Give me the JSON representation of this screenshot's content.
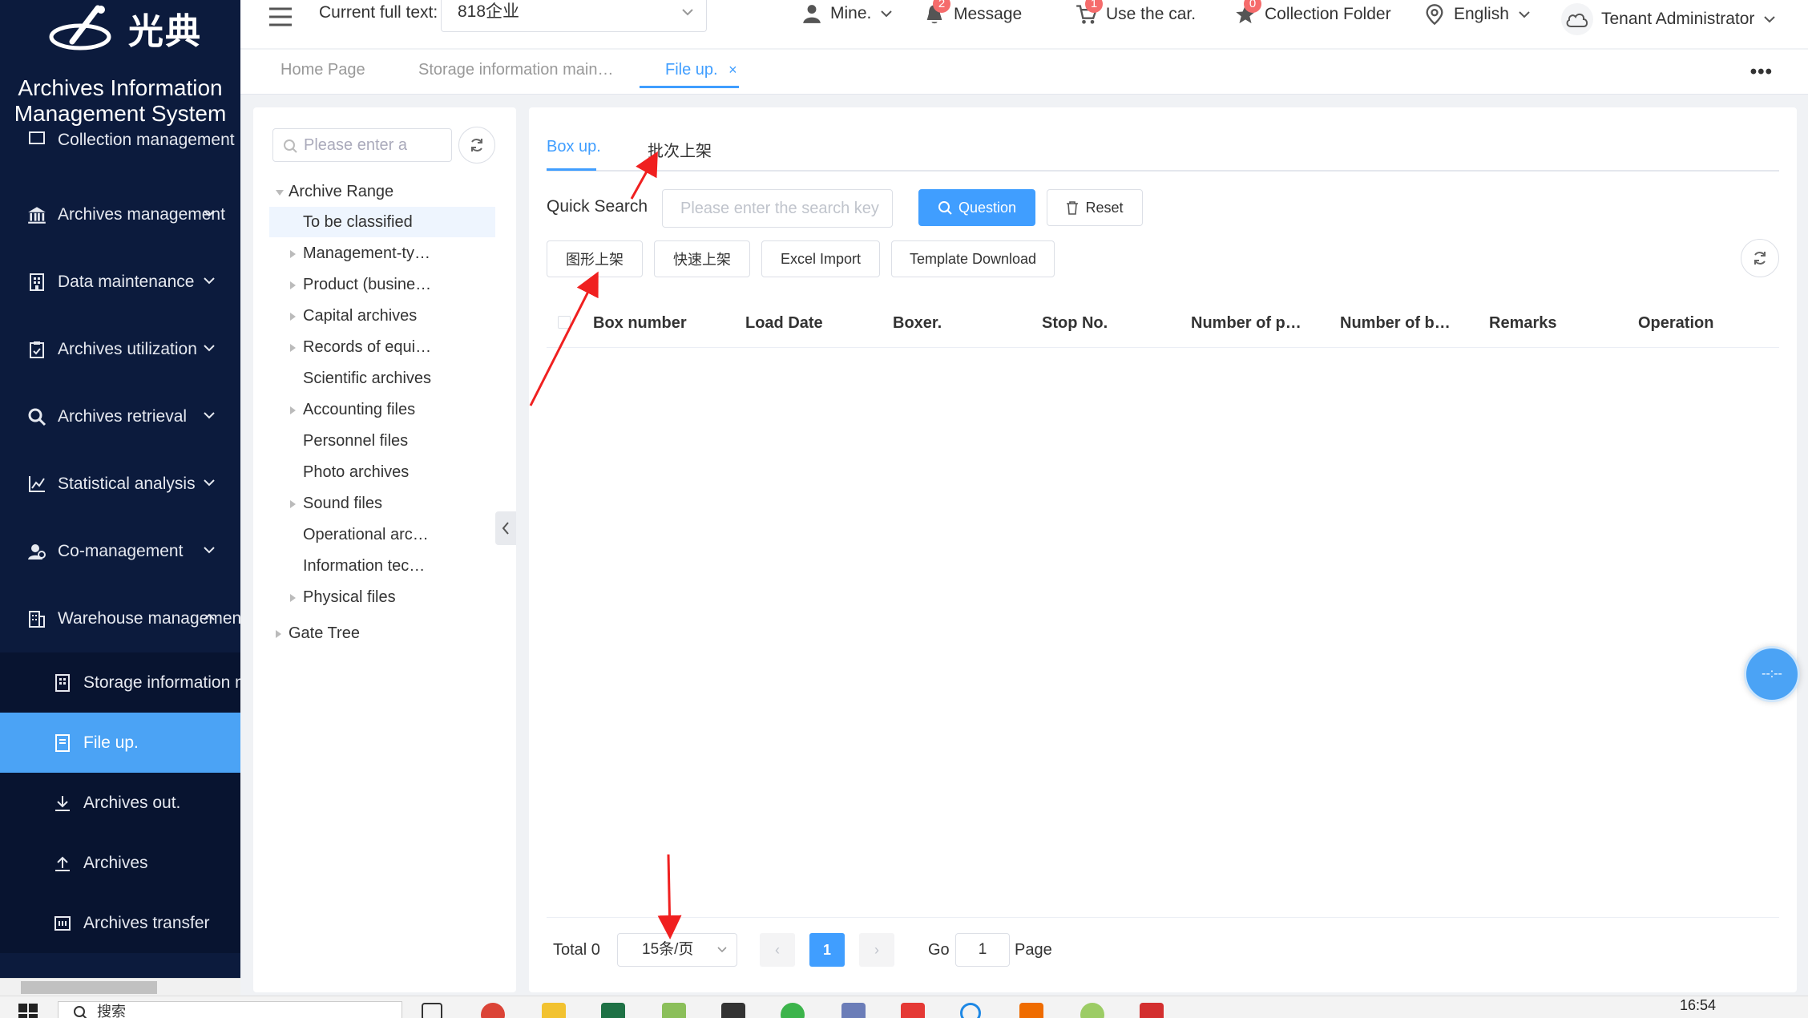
{
  "app": {
    "logo_text": "光典",
    "system_title_line1": "Archives Information",
    "system_title_line2": "Management System"
  },
  "sidebar": {
    "items": [
      {
        "label": "Collection management",
        "icon": "collection-icon"
      },
      {
        "label": "Archives management",
        "icon": "bank-icon"
      },
      {
        "label": "Data maintenance",
        "icon": "building-icon"
      },
      {
        "label": "Archives utilization",
        "icon": "clipboard-icon"
      },
      {
        "label": "Archives retrieval",
        "icon": "search-icon"
      },
      {
        "label": "Statistical analysis",
        "icon": "chart-icon"
      },
      {
        "label": "Co-management",
        "icon": "users-icon"
      },
      {
        "label": "Warehouse management",
        "icon": "warehouse-icon"
      }
    ],
    "sub_items": [
      {
        "label": "Storage information m",
        "icon": "building-icon"
      },
      {
        "label": "File up.",
        "icon": "file-icon"
      },
      {
        "label": "Archives out.",
        "icon": "download-icon"
      },
      {
        "label": "Archives",
        "icon": "upload-icon"
      },
      {
        "label": "Archives transfer",
        "icon": "transfer-icon"
      }
    ]
  },
  "header": {
    "fulltext_label": "Current full text:",
    "fulltext_value": "818企业",
    "mine": "Mine.",
    "message": "Message",
    "message_badge": "2",
    "cart": "Use the car.",
    "cart_badge": "1",
    "collection": "Collection Folder",
    "collection_badge": "0",
    "language": "English",
    "user": "Tenant Administrator"
  },
  "tabs": [
    {
      "label": "Home Page"
    },
    {
      "label": "Storage information main…"
    },
    {
      "label": "File up.",
      "close": "×"
    }
  ],
  "tree": {
    "search_placeholder": "Please enter a",
    "root": "Archive Range",
    "children": [
      "To be classified",
      "Management-ty…",
      "Product (busine…",
      "Capital archives",
      "Records of equi…",
      "Scientific archives",
      "Accounting files",
      "Personnel files",
      "Photo archives",
      "Sound files",
      "Operational arc…",
      "Information tec…",
      "Physical files"
    ],
    "root2": "Gate Tree"
  },
  "main": {
    "subtabs": [
      "Box up.",
      "批次上架"
    ],
    "quick_search_label": "Quick Search",
    "search_placeholder": "Please enter the search key",
    "question_btn": "Question",
    "reset_btn": "Reset",
    "action_btns": [
      "图形上架",
      "快速上架",
      "Excel Import",
      "Template Download"
    ],
    "columns": [
      "Box number",
      "Load Date",
      "Boxer.",
      "Stop No.",
      "Number of p…",
      "Number of b…",
      "Remarks",
      "Operation"
    ],
    "rows": []
  },
  "pagination": {
    "total": "Total 0",
    "page_size": "15条/页",
    "prev": "‹",
    "current": "1",
    "next": "›",
    "go_label": "Go",
    "go_value": "1",
    "page_label": "Page"
  },
  "float_clock": "--:--",
  "taskbar": {
    "search": "搜索",
    "time": "16:54"
  }
}
